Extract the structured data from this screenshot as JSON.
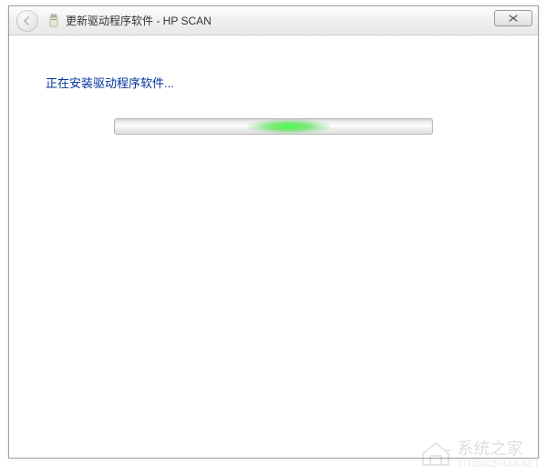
{
  "titlebar": {
    "title": "更新驱动程序软件 - HP SCAN"
  },
  "content": {
    "status_text": "正在安装驱动程序软件..."
  },
  "watermark": {
    "text": "系统之家",
    "sub": "XITONGZHIJIA.NET"
  }
}
